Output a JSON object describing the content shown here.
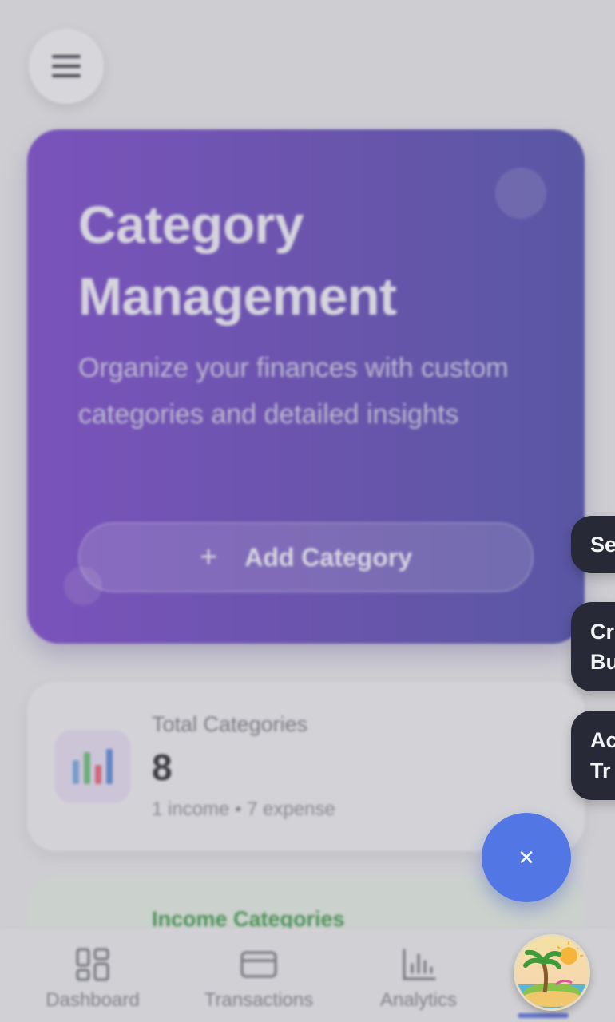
{
  "header": {
    "menu_icon": "hamburger-menu-icon"
  },
  "hero": {
    "title": "Category Management",
    "subtitle": "Organize your finances with custom categories and detailed insights",
    "add_button_icon": "+",
    "add_button_label": "Add Category"
  },
  "stats": {
    "total_label": "Total Categories",
    "total_value": "8",
    "total_breakdown": "1 income • 7 expense",
    "icon": "bar-chart-icon"
  },
  "income": {
    "title": "Income Categories"
  },
  "speed_dial": {
    "actions": [
      {
        "label_lines": [
          "Se"
        ]
      },
      {
        "label_lines": [
          "Cr",
          "Bu"
        ]
      },
      {
        "label_lines": [
          "Ac",
          "Tr"
        ]
      }
    ],
    "close_icon": "×"
  },
  "bottom_nav": {
    "items": [
      {
        "label": "Dashboard",
        "icon": "dashboard-icon"
      },
      {
        "label": "Transactions",
        "icon": "card-icon"
      },
      {
        "label": "Analytics",
        "icon": "analytics-icon"
      }
    ]
  },
  "colors": {
    "hero_gradient_start": "#6b35c2",
    "hero_gradient_end": "#3e3aa2",
    "fab": "#5277e4",
    "income_accent": "#2e8c3c",
    "action_bg": "#272a36"
  }
}
